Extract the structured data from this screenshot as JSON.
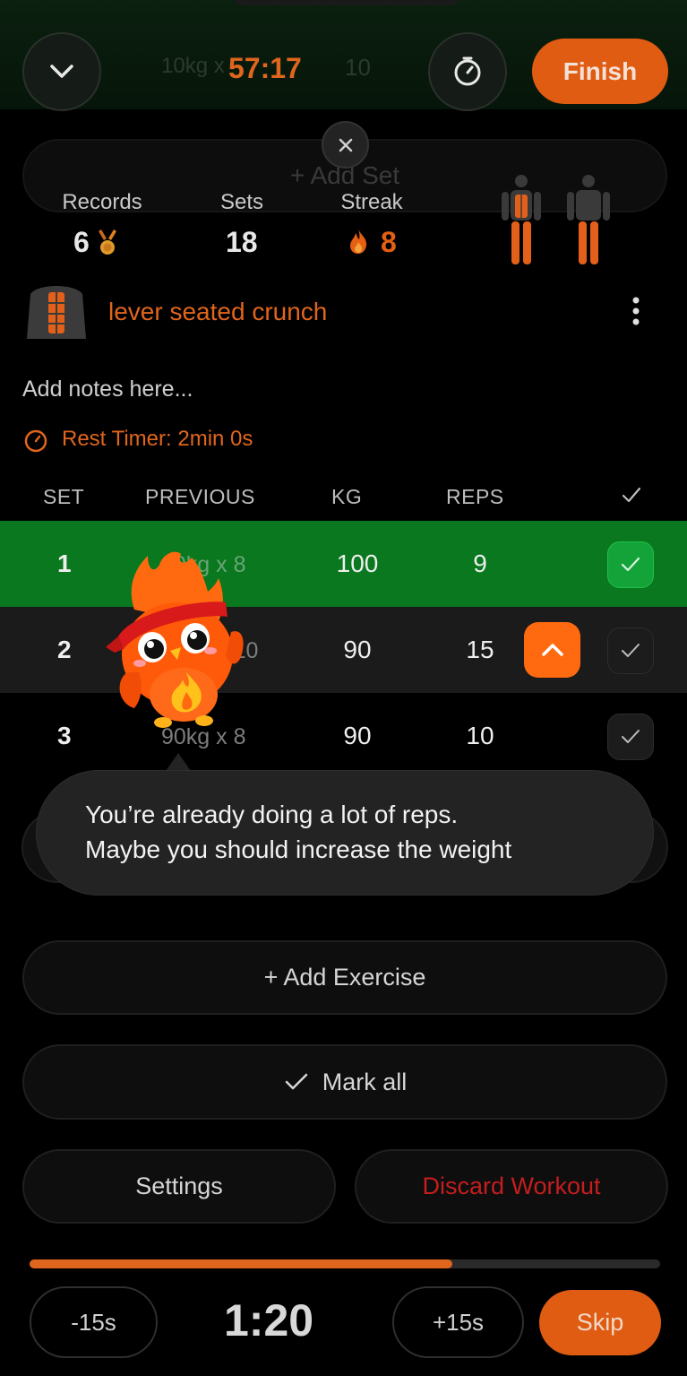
{
  "header": {
    "elapsed": "57:17",
    "ghost_left": "10kg x",
    "ghost_right": "10",
    "finish_label": "Finish"
  },
  "ghost_add_set": "+ Add Set",
  "stats": {
    "records_label": "Records",
    "records_value": "6",
    "sets_label": "Sets",
    "sets_value": "18",
    "streak_label": "Streak",
    "streak_value": "8"
  },
  "exercise": {
    "name": "lever seated crunch",
    "notes_placeholder": "Add notes here...",
    "rest_timer": "Rest Timer: 2min 0s"
  },
  "table": {
    "headers": {
      "set": "SET",
      "previous": "PREVIOUS",
      "kg": "KG",
      "reps": "REPS"
    },
    "rows": [
      {
        "set": "1",
        "previous": "90kg x 8",
        "kg": "100",
        "reps": "9",
        "done": true
      },
      {
        "set": "2",
        "previous": "90kg x 10",
        "kg": "90",
        "reps": "15",
        "done": false
      },
      {
        "set": "3",
        "previous": "90kg x 8",
        "kg": "90",
        "reps": "10",
        "done": false
      }
    ]
  },
  "tooltip": {
    "line1": "You’re already doing a lot of reps.",
    "line2": "Maybe you should increase the weight"
  },
  "actions": {
    "add_exercise": "+ Add Exercise",
    "mark_all": "Mark all",
    "settings": "Settings",
    "discard": "Discard Workout"
  },
  "rest": {
    "progress": 0.67,
    "minus": "-15s",
    "countdown": "1:20",
    "plus": "+15s",
    "skip": "Skip"
  },
  "colors": {
    "accent": "#e0651d",
    "row_done": "#09781f",
    "danger": "#c41e1e"
  }
}
